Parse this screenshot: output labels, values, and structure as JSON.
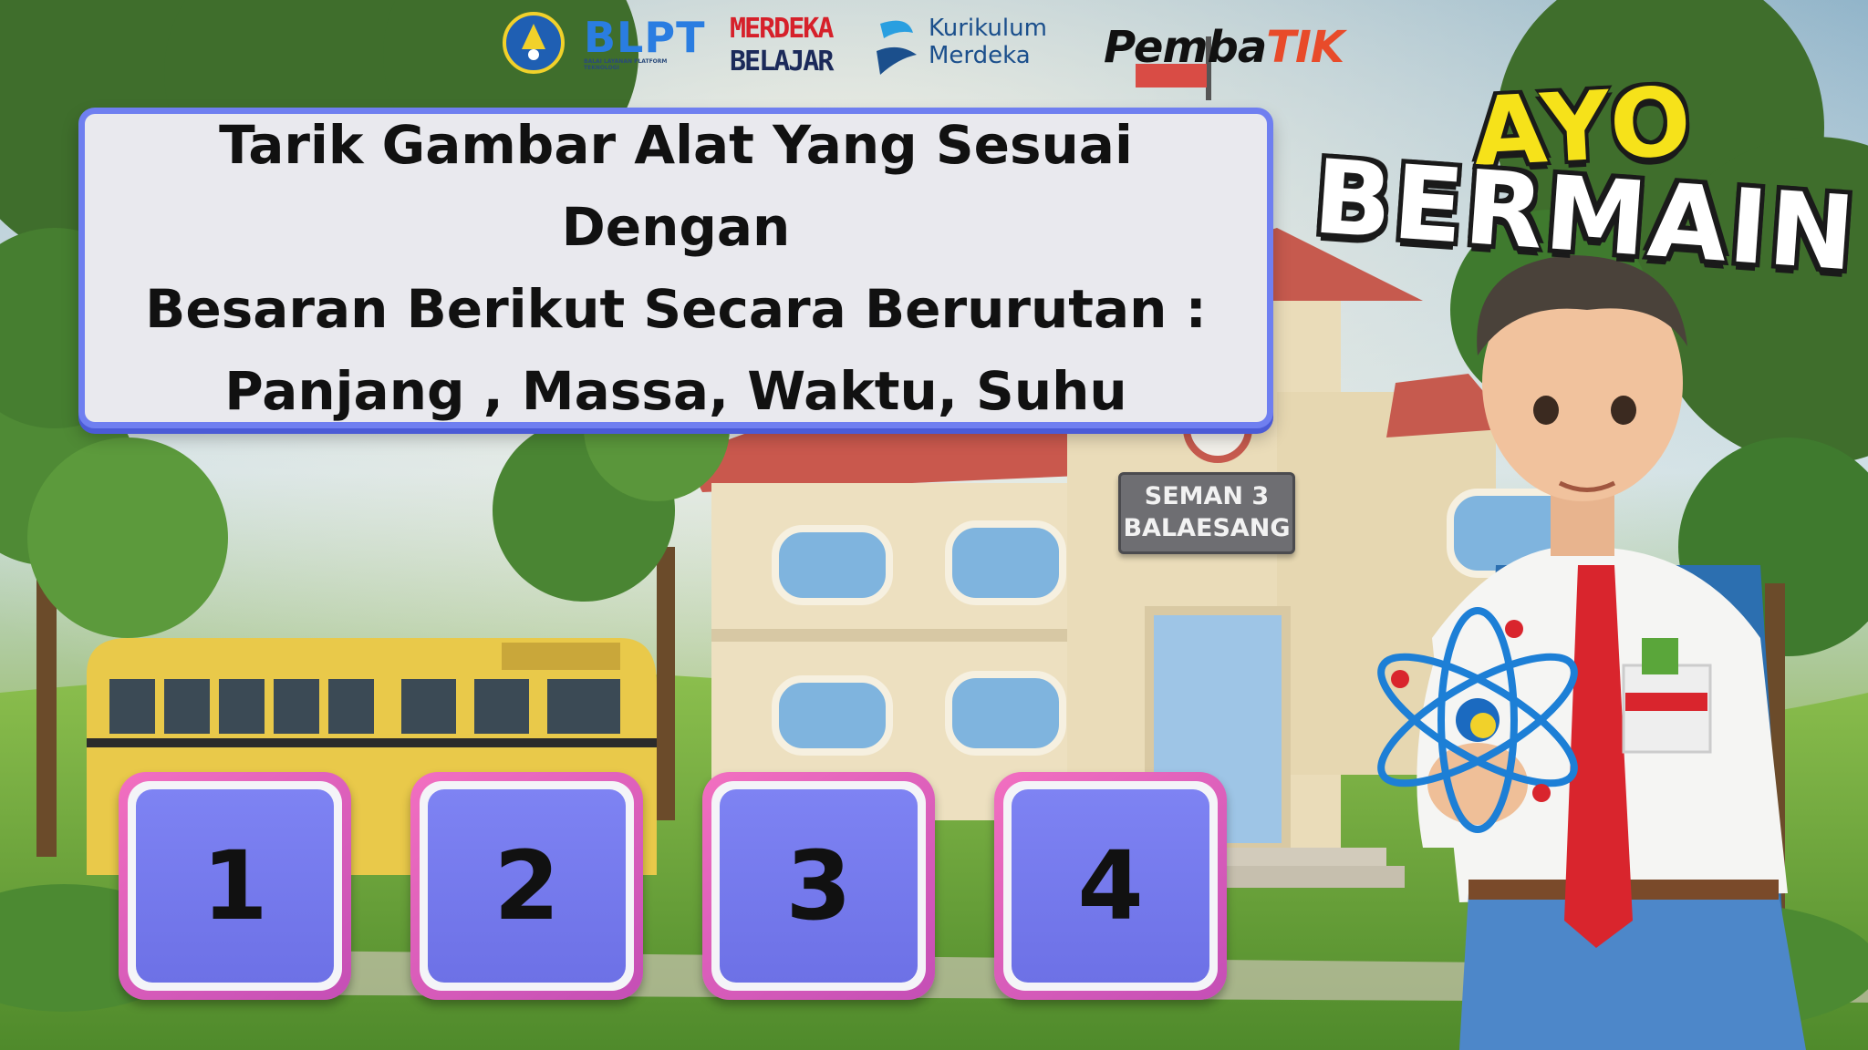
{
  "logos": {
    "blpt": "BLPT",
    "blpt_sub": "BALAI LAYANAN PLATFORM TEKNOLOGI",
    "merdeka_line1": "MERDEKA",
    "merdeka_line2": "BELAJAR",
    "kurikulum_line1": "Kurikulum",
    "kurikulum_line2": "Merdeka",
    "pemba_main": "Pemba",
    "pemba_accent": "TIK"
  },
  "instruction": {
    "line1": "Tarik Gambar Alat Yang Sesuai Dengan",
    "line2": "Besaran Berikut Secara Berurutan :",
    "line3": "Panjang , Massa, Waktu, Suhu"
  },
  "title": {
    "top": "AYO",
    "bottom": "BERMAIN"
  },
  "school_sign": {
    "line1": "SEMAN 3",
    "line2": "BALAESANG"
  },
  "slots": [
    "1",
    "2",
    "3",
    "4"
  ],
  "colors": {
    "panel_border": "#6f7ff0",
    "slot_outer": "#e55fbd",
    "slot_face": "#757aee",
    "title_yellow": "#f6e21a"
  },
  "icons": {
    "emblem": "tut-wuri-handayani-emblem",
    "kurikulum": "kurikulum-merdeka-swoosh-icon",
    "pembatik": "pembatik-logo-mark",
    "atom": "atom-model-icon"
  }
}
